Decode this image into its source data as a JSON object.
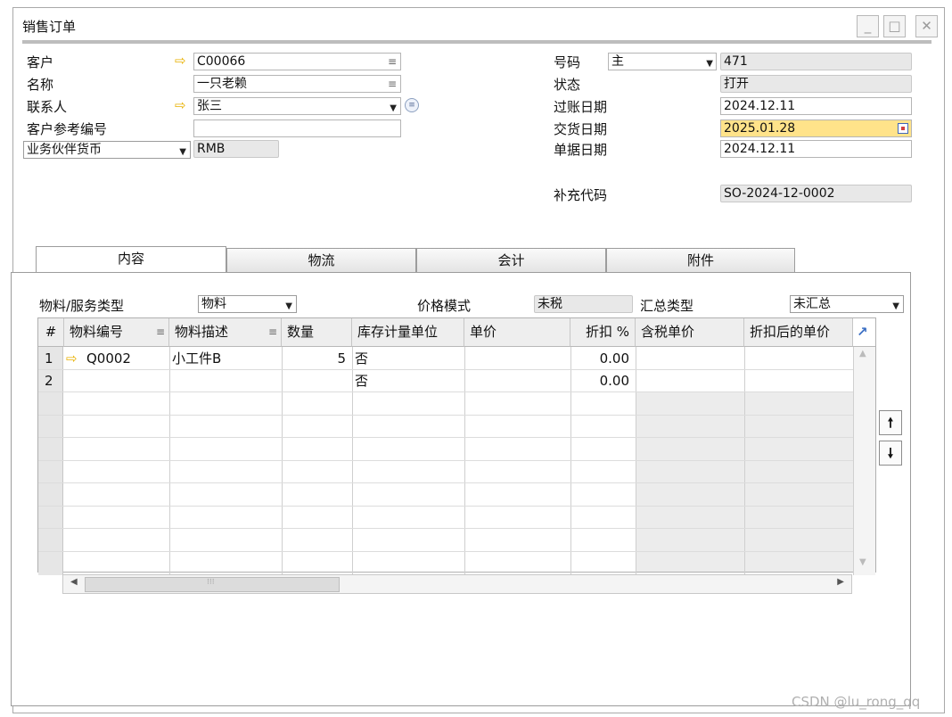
{
  "window": {
    "title": "销售订单",
    "min_glyph": "_",
    "max_glyph": "□",
    "close_glyph": "✕"
  },
  "header": {
    "customer_label": "客户",
    "customer_value": "C00066",
    "name_label": "名称",
    "name_value": "一只老赖",
    "contact_label": "联系人",
    "contact_value": "张三",
    "ref_label": "客户参考编号",
    "ref_value": "",
    "currency_label": "业务伙伴货币",
    "currency_value": "RMB",
    "number_label": "号码",
    "series_value": "主",
    "number_value": "471",
    "status_label": "状态",
    "status_value": "打开",
    "posting_date_label": "过账日期",
    "posting_date_value": "2024.12.11",
    "delivery_date_label": "交货日期",
    "delivery_date_value": "2025.01.28",
    "doc_date_label": "单据日期",
    "doc_date_value": "2024.12.11",
    "extra_code_label": "补充代码",
    "extra_code_value": "SO-2024-12-0002"
  },
  "tabs": [
    {
      "label": "内容",
      "active": true
    },
    {
      "label": "物流",
      "active": false
    },
    {
      "label": "会计",
      "active": false
    },
    {
      "label": "附件",
      "active": false
    }
  ],
  "content": {
    "item_type_label": "物料/服务类型",
    "item_type_value": "物料",
    "price_mode_label": "价格模式",
    "price_mode_value": "未税",
    "summary_type_label": "汇总类型",
    "summary_type_value": "未汇总"
  },
  "grid": {
    "columns": [
      "#",
      "物料编号",
      "物料描述",
      "数量",
      "库存计量单位",
      "单价",
      "折扣 %",
      "含税单价",
      "折扣后的单价"
    ],
    "rows": [
      {
        "no": "1",
        "item_code": "Q0002",
        "item_desc": "小工件B",
        "qty": "5",
        "uom": "否",
        "price": "",
        "discount": "0.00",
        "gross_price": "",
        "net_price": ""
      },
      {
        "no": "2",
        "item_code": "",
        "item_desc": "",
        "qty": "",
        "uom": "否",
        "price": "",
        "discount": "0.00",
        "gross_price": "",
        "net_price": ""
      }
    ]
  },
  "watermark": "CSDN @lu_rong_qq",
  "icons": {
    "link_arrow": "link-arrow-icon",
    "lines": "list-lines-icon",
    "dropdown": "dropdown-arrow-icon",
    "calendar": "calendar-icon",
    "expand": "expand-corner-icon",
    "move_up": "move-up-icon",
    "move_down": "move-down-icon"
  },
  "colors": {
    "highlight_field": "#ffe38a",
    "readonly_field": "#e8e8e8",
    "link_arrow": "#e8b000"
  }
}
